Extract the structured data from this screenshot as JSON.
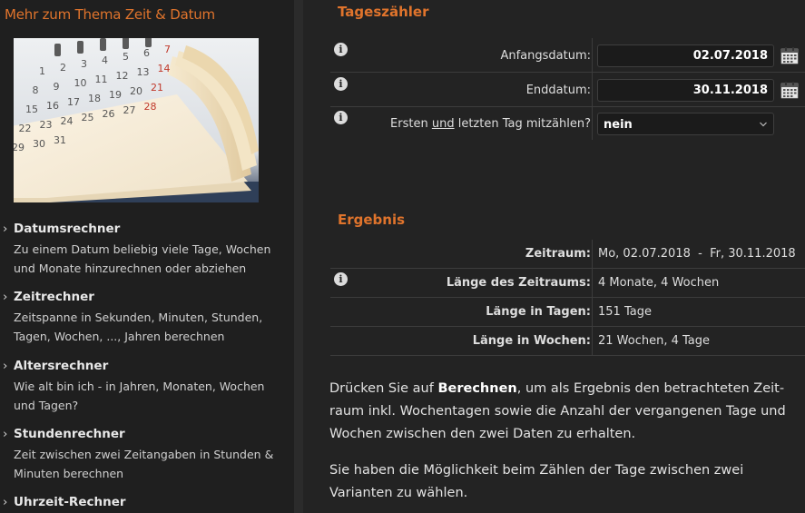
{
  "sidebar": {
    "title": "Mehr zum Thema Zeit & Datum",
    "links": [
      {
        "title": "Datumsrechner",
        "desc": "Zu einem Datum beliebig viele Tage, Wochen und Monate hinzurechnen oder abziehen"
      },
      {
        "title": "Zeitrechner",
        "desc": "Zeitspanne in Sekunden, Minuten, Stunden, Tagen, Wochen, ..., Jahren berechnen"
      },
      {
        "title": "Altersrechner",
        "desc": "Wie alt bin ich - in Jahren, Monaten, Wochen und Tagen?"
      },
      {
        "title": "Stundenrechner",
        "desc": "Zeit zwischen zwei Zeitangaben in Stunden & Minuten berechnen"
      },
      {
        "title": "Uhrzeit-Rechner",
        "desc": ""
      }
    ],
    "chevron": "›",
    "calendar_numbers": [
      "1",
      "2",
      "3",
      "4",
      "5",
      "6",
      "7",
      "8",
      "9",
      "10",
      "11",
      "12",
      "13",
      "14",
      "15",
      "16",
      "17",
      "18",
      "19",
      "20",
      "21",
      "22",
      "23",
      "24",
      "25",
      "26",
      "27",
      "28",
      "29",
      "30",
      "31"
    ]
  },
  "form": {
    "title": "Tageszähler",
    "start_label": "Anfangsdatum:",
    "start_value": "02.07.2018",
    "end_label": "Enddatum:",
    "end_value": "30.11.2018",
    "count_label_pre": "Ersten ",
    "count_label_und": "und",
    "count_label_post": " letzten Tag mitzählen?",
    "count_value": "nein"
  },
  "result": {
    "title": "Ergebnis",
    "rows": [
      {
        "label": "Zeitraum:",
        "value": "Mo, 02.07.2018  -  Fr, 30.11.2018"
      },
      {
        "label": "Länge des Zeitraums:",
        "value": "4 Monate, 4 Wochen"
      },
      {
        "label": "Länge in Tagen:",
        "value": "151 Tage"
      },
      {
        "label": "Länge in Wochen:",
        "value": "21 Wochen, 4 Tage"
      }
    ]
  },
  "description": {
    "p1_pre": "Drücken Sie auf ",
    "p1_bold": "Berechnen",
    "p1_post": ", um als Ergebnis den betrachteten Zeit­raum inkl. Wochentagen sowie die Anzahl der vergangenen Tage und Wochen zwischen den zwei Daten zu erhalten.",
    "p2": "Sie haben die Möglichkeit beim Zählen der Tage zwischen zwei Varianten zu wählen."
  },
  "info_glyph": "i",
  "colors": {
    "accent": "#e0742c",
    "background": "#222222",
    "sidebar": "#1f1f1f"
  }
}
